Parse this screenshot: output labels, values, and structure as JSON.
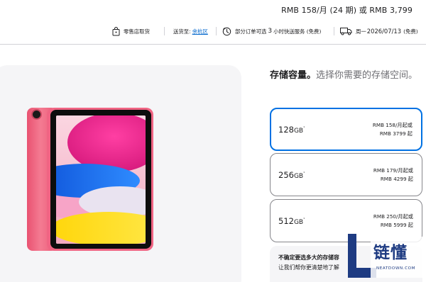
{
  "header": {
    "price_line": "RMB 158/月 (24 期) 或 RMB 3,799"
  },
  "info_bar": {
    "pickup_label": "零售店取货",
    "delivery_prefix": "送货至:",
    "delivery_location": "余杭区",
    "express_before": "部分订单可选",
    "express_hours": "3",
    "express_after": "小时快送服务 (免费)",
    "ship_day": "周一",
    "ship_date": "2026/07/13",
    "ship_fee": "(免费)"
  },
  "storage": {
    "title_bold": "存储容量。",
    "title_rest": "选择你需要的存储空间。",
    "options": [
      {
        "size": "128",
        "unit": "GB",
        "footnote": "¹",
        "monthly": "RMB 158/月起或",
        "full": "RMB 3799 起",
        "selected": true
      },
      {
        "size": "256",
        "unit": "GB",
        "footnote": "¹",
        "monthly": "RMB 179/月起或",
        "full": "RMB 4299 起",
        "selected": false
      },
      {
        "size": "512",
        "unit": "GB",
        "footnote": "¹",
        "monthly": "RMB 250/月起或",
        "full": "RMB 5999 起",
        "selected": false
      }
    ],
    "help_question": "不确定要选多大的存储容",
    "help_answer": "让我们帮你更清楚地了解"
  },
  "watermark": {
    "text": "链懂",
    "sub": "NEATDOWN.COM"
  },
  "colors": {
    "accent_blue": "#0071e3",
    "link_blue": "#0066cc",
    "ipad_pink": "#f06483",
    "watermark_navy": "#1e3b82"
  },
  "icons": [
    "store-bag-icon",
    "clock-icon",
    "truck-icon"
  ]
}
